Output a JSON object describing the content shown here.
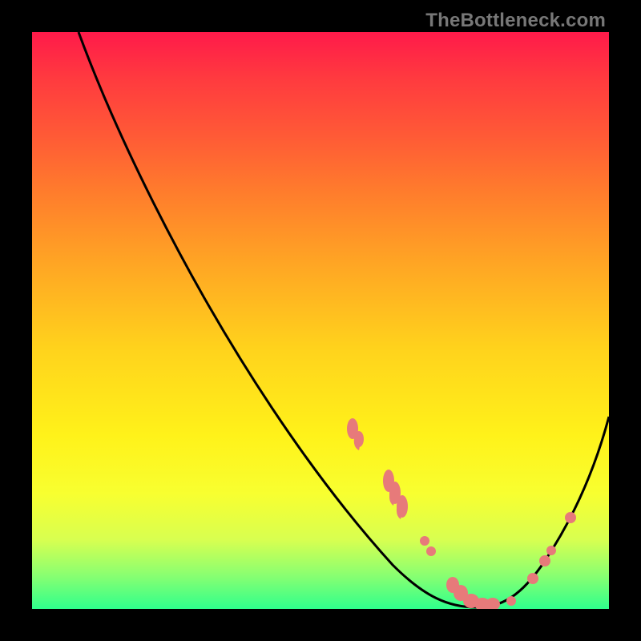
{
  "watermark": "TheBottleneck.com",
  "chart_data": {
    "type": "line",
    "title": "",
    "xlabel": "",
    "ylabel": "",
    "xlim": [
      0,
      100
    ],
    "ylim": [
      0,
      100
    ],
    "grid": false,
    "legend": false,
    "note": "No axis ticks or numeric labels visible. Values are visual estimates of the curve and marker positions on a 0–100 grid.",
    "series": [
      {
        "name": "curve",
        "x": [
          8,
          12,
          18,
          25,
          33,
          41,
          49,
          56,
          62,
          67,
          72,
          76,
          80,
          84,
          88,
          92,
          96,
          100
        ],
        "y": [
          100,
          95,
          87,
          77,
          66,
          54,
          42,
          31,
          21,
          13,
          7,
          3,
          1,
          2,
          6,
          13,
          22,
          33
        ]
      },
      {
        "name": "highlighted-points",
        "x": [
          56,
          57,
          58,
          62,
          63,
          64,
          68,
          69,
          73,
          74,
          76,
          78,
          80,
          82,
          85,
          89,
          90,
          93
        ],
        "y": [
          31,
          29,
          28,
          21,
          20,
          19,
          12,
          11,
          6,
          5,
          3,
          2,
          1,
          1,
          2,
          7,
          8,
          14
        ]
      }
    ]
  },
  "colors": {
    "curve": "#000000",
    "marker": "#e77a7a",
    "bg_top": "#ff1a4a",
    "bg_bottom": "#2fff8c"
  }
}
